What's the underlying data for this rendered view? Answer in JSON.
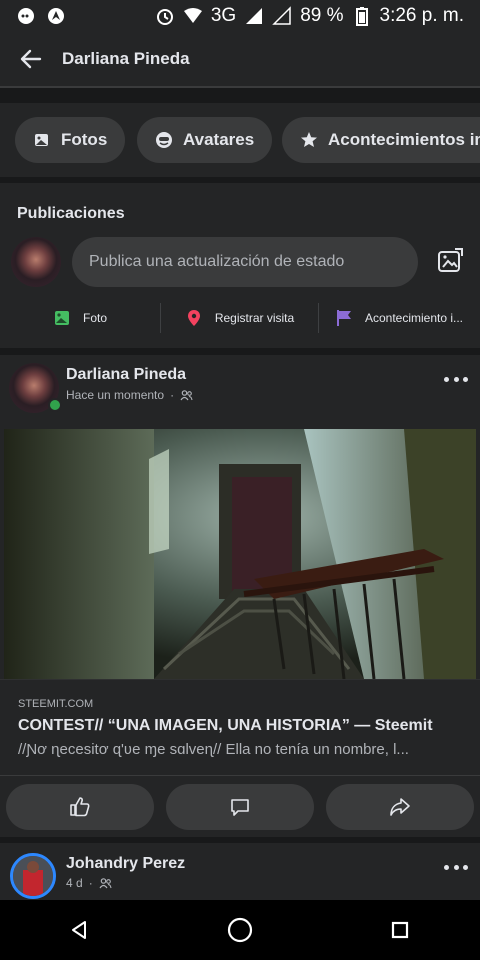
{
  "status_bar": {
    "battery": "89 %",
    "network": "3G",
    "time": "3:26 p. m."
  },
  "header": {
    "title": "Darliana Pineda"
  },
  "chips": [
    {
      "label": "Fotos",
      "icon": "photos-icon"
    },
    {
      "label": "Avatares",
      "icon": "avatar-icon"
    },
    {
      "label": "Acontecimientos im",
      "icon": "star-icon"
    }
  ],
  "publications": {
    "heading": "Publicaciones",
    "composer_placeholder": "Publica una actualización de estado",
    "actions": [
      {
        "label": "Foto",
        "icon": "photo-icon",
        "color": "#45bd62"
      },
      {
        "label": "Registrar visita",
        "icon": "location-pin-icon",
        "color": "#f3425f"
      },
      {
        "label": "Acontecimiento i...",
        "icon": "flag-icon",
        "color": "#8c6cd6"
      }
    ]
  },
  "post": {
    "author": "Darliana Pineda",
    "time": "Hace un momento",
    "link": {
      "domain": "STEEMIT.COM",
      "title": "CONTEST// “UNA IMAGEN, UNA HISTORIA” — Steemit",
      "description": "//Ɲơ ɳecesitơ ɋ'ʋe ɱe sɑlveɳ// Ella no tenía un nombre, l..."
    }
  },
  "post2": {
    "author": "Johandry Perez",
    "time": "4 d"
  },
  "colors": {
    "background": "#18191a",
    "card": "#242526",
    "chip": "#3a3b3c",
    "online": "#31a24c",
    "story_ring": "#2d88ff"
  }
}
